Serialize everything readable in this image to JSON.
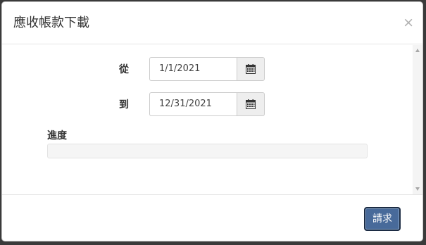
{
  "dialog": {
    "title": "應收帳款下載",
    "close_symbol": "×"
  },
  "form": {
    "from_label": "從",
    "from_value": "1/1/2021",
    "to_label": "到",
    "to_value": "12/31/2021",
    "progress_label": "進度",
    "progress_value": 0
  },
  "footer": {
    "submit_label": "請求"
  },
  "icons": {
    "calendar": "calendar-icon",
    "close": "close-icon"
  },
  "colors": {
    "primary_button": "#486a9a",
    "progress_fill": "#5b7fae"
  }
}
